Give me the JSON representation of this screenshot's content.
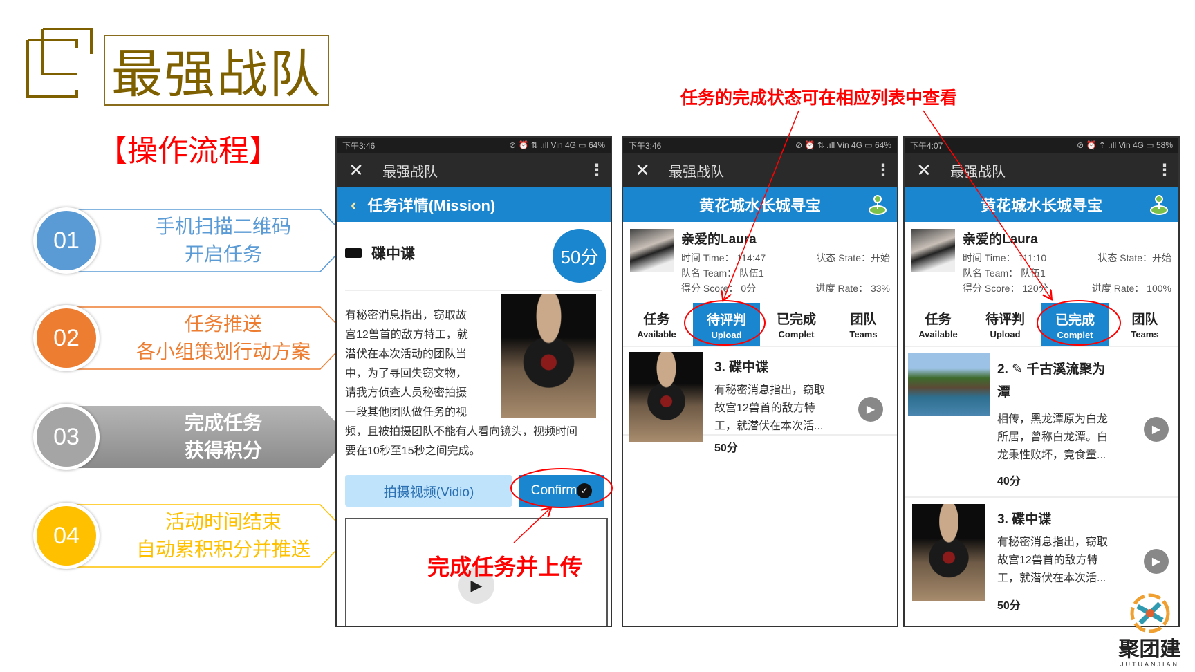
{
  "header": {
    "title": "最强战队",
    "subtitle": "【操作流程】"
  },
  "steps": [
    {
      "num": "01",
      "line1": "手机扫描二维码",
      "line2": "开启任务",
      "color": "#5b9bd5"
    },
    {
      "num": "02",
      "line1": "任务推送",
      "line2": "各小组策划行动方案",
      "color": "#ed7d31"
    },
    {
      "num": "03",
      "line1": "完成任务",
      "line2": "获得积分",
      "color": "#a5a5a5"
    },
    {
      "num": "04",
      "line1": "活动时间结束",
      "line2": "自动累积积分并推送",
      "color": "#ffc000"
    }
  ],
  "annotations": {
    "top": "任务的完成状态可在相应列表中查看",
    "bottom": "完成任务并上传"
  },
  "phone1": {
    "status": {
      "time": "下午3:46",
      "right": "⊘ ⏰ ⇅ .ıll Vin 4G ▭ 64%"
    },
    "app_title": "最强战队",
    "page_title": "任务详情(Mission)",
    "mission_name": "碟中谍",
    "score": "50分",
    "desc_lines": [
      "有秘密消息指出，窃取故",
      "宫12兽首的敌方特工，就",
      "潜伏在本次活动的团队当",
      "中，为了寻回失窃文物，",
      "请我方侦查人员秘密拍摄",
      "一段其他团队做任务的视"
    ],
    "desc_full": [
      "频，且被拍摄团队不能有人看向镜头，视频时间",
      "要在10秒至15秒之间完成。"
    ],
    "shoot_button": "拍摄视频(Vidio)",
    "confirm_button": "Confirm"
  },
  "phone2": {
    "status": {
      "time": "下午3:46",
      "right": "⊘ ⏰ ⇅ .ıll Vin 4G ▭ 64%"
    },
    "app_title": "最强战队",
    "page_title": "黄花城水长城寻宝",
    "user": {
      "name": "亲爱的Laura",
      "time": "时间 Time： 114:47",
      "state": "状态 State：开始",
      "team": "队名 Team： 队伍1",
      "score": "得分 Score： 0分",
      "rate": "进度 Rate： 33%"
    },
    "tabs": [
      {
        "zh": "任务",
        "en": "Available"
      },
      {
        "zh": "待评判",
        "en": "Upload",
        "active": true
      },
      {
        "zh": "已完成",
        "en": "Complet"
      },
      {
        "zh": "团队",
        "en": "Teams"
      }
    ],
    "items": [
      {
        "title": "3. 碟中谍",
        "desc": [
          "有秘密消息指出，窃取",
          "故宫12兽首的敌方特",
          "工，就潜伏在本次活..."
        ],
        "score": "50分"
      }
    ]
  },
  "phone3": {
    "status": {
      "time": "下午4:07",
      "right": "⊘ ⏰ ⇡ .ıll Vin 4G ▭ 58%"
    },
    "app_title": "最强战队",
    "page_title": "黄花城水长城寻宝",
    "user": {
      "name": "亲爱的Laura",
      "time": "时间 Time： 111:10",
      "state": "状态 State：开始",
      "team": "队名 Team： 队伍1",
      "score": "得分 Score： 120分",
      "rate": "进度 Rate： 100%"
    },
    "tabs": [
      {
        "zh": "任务",
        "en": "Available"
      },
      {
        "zh": "待评判",
        "en": "Upload"
      },
      {
        "zh": "已完成",
        "en": "Complet",
        "active": true
      },
      {
        "zh": "团队",
        "en": "Teams"
      }
    ],
    "items": [
      {
        "title1": "2. ✎ 千古溪流聚为",
        "title2": "潭",
        "desc": [
          "相传，黑龙潭原为白龙",
          "所居，曾称白龙潭。白",
          "龙秉性败坏，竟食童..."
        ],
        "score": "40分"
      },
      {
        "title": "3. 碟中谍",
        "desc": [
          "有秘密消息指出，窃取",
          "故宫12兽首的敌方特",
          "工，就潜伏在本次活..."
        ],
        "score": "50分"
      }
    ]
  },
  "logo": {
    "name": "聚团建",
    "sub": "JUTUANJIAN"
  },
  "colors": {
    "brand_gold": "#7f6000",
    "accent_red": "#ff0000",
    "app_blue": "#1a86cf"
  }
}
